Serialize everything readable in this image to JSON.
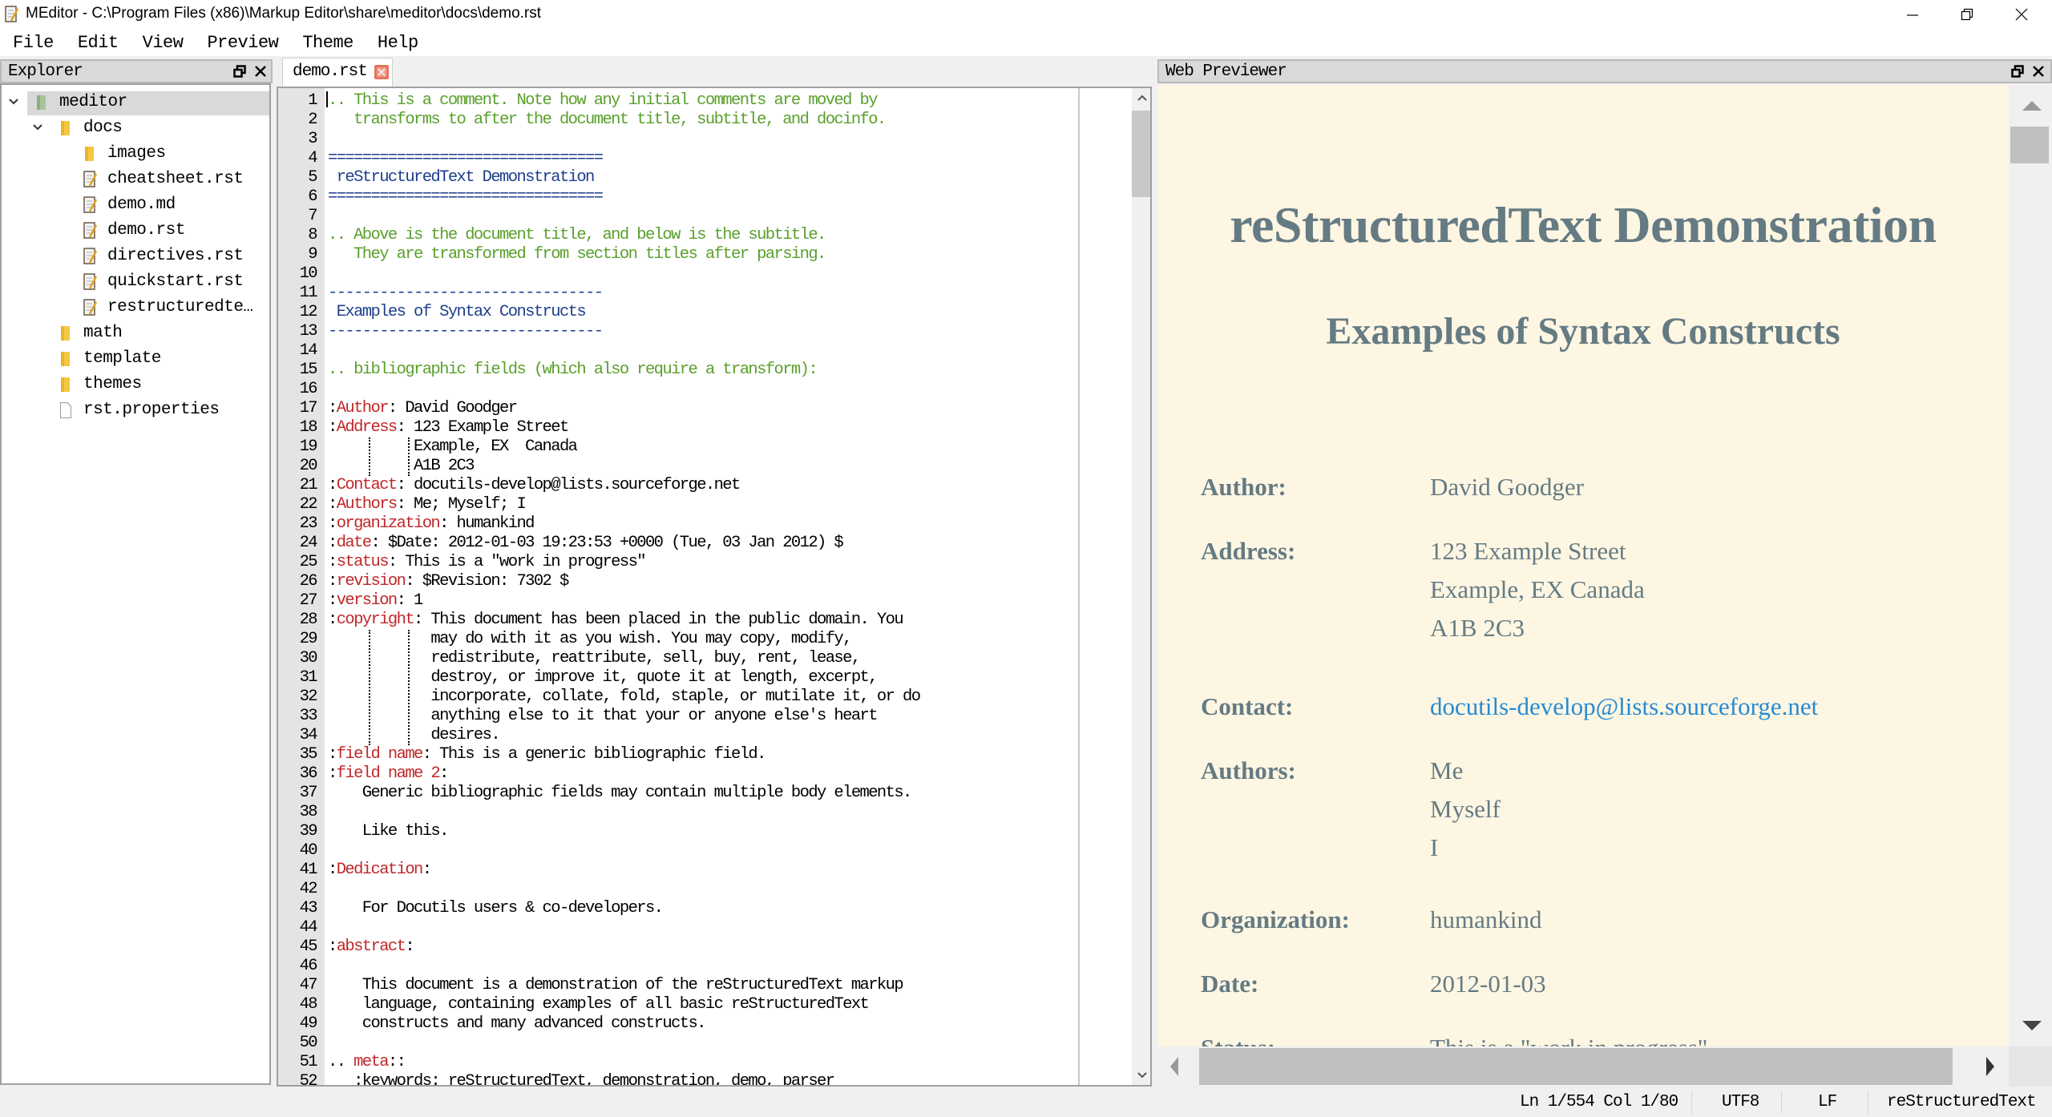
{
  "window": {
    "title": "MEditor - C:\\Program Files (x86)\\Markup Editor\\share\\meditor\\docs\\demo.rst",
    "controls": [
      "minimize",
      "restore",
      "close"
    ]
  },
  "menu": [
    "File",
    "Edit",
    "View",
    "Preview",
    "Theme",
    "Help"
  ],
  "explorer": {
    "title": "Explorer",
    "tree": [
      {
        "label": "meditor",
        "type": "root-folder",
        "depth": 0,
        "expanded": true,
        "selected": true
      },
      {
        "label": "docs",
        "type": "folder",
        "depth": 1,
        "expanded": true
      },
      {
        "label": "images",
        "type": "folder",
        "depth": 2
      },
      {
        "label": "cheatsheet.rst",
        "type": "doc",
        "depth": 2
      },
      {
        "label": "demo.md",
        "type": "doc",
        "depth": 2
      },
      {
        "label": "demo.rst",
        "type": "doc",
        "depth": 2
      },
      {
        "label": "directives.rst",
        "type": "doc",
        "depth": 2
      },
      {
        "label": "quickstart.rst",
        "type": "doc",
        "depth": 2
      },
      {
        "label": "restructuredte…",
        "type": "doc",
        "depth": 2
      },
      {
        "label": "math",
        "type": "folder",
        "depth": 1
      },
      {
        "label": "template",
        "type": "folder",
        "depth": 1
      },
      {
        "label": "themes",
        "type": "folder",
        "depth": 1
      },
      {
        "label": "rst.properties",
        "type": "file",
        "depth": 1
      }
    ]
  },
  "editor": {
    "tab": {
      "label": "demo.rst",
      "close_icon": "close-tab-icon"
    },
    "lines": [
      [
        {
          "t": ".. This is a comment. Note how any initial comments are moved by",
          "c": "comment"
        }
      ],
      [
        {
          "t": "   transforms to after the document title, subtitle, and docinfo.",
          "c": "comment"
        }
      ],
      [],
      [
        {
          "t": "================================",
          "c": "title"
        }
      ],
      [
        {
          "t": " reStructuredText Demonstration",
          "c": "title"
        }
      ],
      [
        {
          "t": "================================",
          "c": "title"
        }
      ],
      [],
      [
        {
          "t": ".. Above is the document title, and below is the subtitle.",
          "c": "comment"
        }
      ],
      [
        {
          "t": "   They are transformed from section titles after parsing.",
          "c": "comment"
        }
      ],
      [],
      [
        {
          "t": "--------------------------------",
          "c": "title"
        }
      ],
      [
        {
          "t": " Examples of Syntax Constructs",
          "c": "title"
        }
      ],
      [
        {
          "t": "--------------------------------",
          "c": "title"
        }
      ],
      [],
      [
        {
          "t": ".. bibliographic fields (which also require a transform):",
          "c": "comment"
        }
      ],
      [],
      [
        {
          "t": ":",
          "c": "plain"
        },
        {
          "t": "Author",
          "c": "field"
        },
        {
          "t": ": David Goodger",
          "c": "plain"
        }
      ],
      [
        {
          "t": ":",
          "c": "plain"
        },
        {
          "t": "Address",
          "c": "field"
        },
        {
          "t": ": 123 Example Street",
          "c": "plain"
        }
      ],
      [
        {
          "t": "          Example, EX  Canada",
          "c": "plain"
        }
      ],
      [
        {
          "t": "          A1B 2C3",
          "c": "plain"
        }
      ],
      [
        {
          "t": ":",
          "c": "plain"
        },
        {
          "t": "Contact",
          "c": "field"
        },
        {
          "t": ": docutils-develop@lists.sourceforge.net",
          "c": "plain"
        }
      ],
      [
        {
          "t": ":",
          "c": "plain"
        },
        {
          "t": "Authors",
          "c": "field"
        },
        {
          "t": ": Me; Myself; I",
          "c": "plain"
        }
      ],
      [
        {
          "t": ":",
          "c": "plain"
        },
        {
          "t": "organization",
          "c": "field"
        },
        {
          "t": ": humankind",
          "c": "plain"
        }
      ],
      [
        {
          "t": ":",
          "c": "plain"
        },
        {
          "t": "date",
          "c": "field"
        },
        {
          "t": ": $Date: 2012-01-03 19:23:53 +0000 (Tue, 03 Jan 2012) $",
          "c": "plain"
        }
      ],
      [
        {
          "t": ":",
          "c": "plain"
        },
        {
          "t": "status",
          "c": "field"
        },
        {
          "t": ": This is a \"work in progress\"",
          "c": "plain"
        }
      ],
      [
        {
          "t": ":",
          "c": "plain"
        },
        {
          "t": "revision",
          "c": "field"
        },
        {
          "t": ": $Revision: 7302 $",
          "c": "plain"
        }
      ],
      [
        {
          "t": ":",
          "c": "plain"
        },
        {
          "t": "version",
          "c": "field"
        },
        {
          "t": ": 1",
          "c": "plain"
        }
      ],
      [
        {
          "t": ":",
          "c": "plain"
        },
        {
          "t": "copyright",
          "c": "field"
        },
        {
          "t": ": This document has been placed in the public domain. You",
          "c": "plain"
        }
      ],
      [
        {
          "t": "            may do with it as you wish. You may copy, modify,",
          "c": "plain"
        }
      ],
      [
        {
          "t": "            redistribute, reattribute, sell, buy, rent, lease,",
          "c": "plain"
        }
      ],
      [
        {
          "t": "            destroy, or improve it, quote it at length, excerpt,",
          "c": "plain"
        }
      ],
      [
        {
          "t": "            incorporate, collate, fold, staple, or mutilate it, or do",
          "c": "plain"
        }
      ],
      [
        {
          "t": "            anything else to it that your or anyone else's heart",
          "c": "plain"
        }
      ],
      [
        {
          "t": "            desires.",
          "c": "plain"
        }
      ],
      [
        {
          "t": ":",
          "c": "plain"
        },
        {
          "t": "field name",
          "c": "field"
        },
        {
          "t": ": This is a generic bibliographic field.",
          "c": "plain"
        }
      ],
      [
        {
          "t": ":",
          "c": "plain"
        },
        {
          "t": "field name 2",
          "c": "field"
        },
        {
          "t": ":",
          "c": "plain"
        }
      ],
      [
        {
          "t": "    Generic bibliographic fields may contain multiple body elements.",
          "c": "plain"
        }
      ],
      [],
      [
        {
          "t": "    Like this.",
          "c": "plain"
        }
      ],
      [],
      [
        {
          "t": ":",
          "c": "plain"
        },
        {
          "t": "Dedication",
          "c": "field"
        },
        {
          "t": ":",
          "c": "plain"
        }
      ],
      [],
      [
        {
          "t": "    For Docutils users & co-developers.",
          "c": "plain"
        }
      ],
      [],
      [
        {
          "t": ":",
          "c": "plain"
        },
        {
          "t": "abstract",
          "c": "field"
        },
        {
          "t": ":",
          "c": "plain"
        }
      ],
      [],
      [
        {
          "t": "    This document is a demonstration of the reStructuredText markup",
          "c": "plain"
        }
      ],
      [
        {
          "t": "    language, containing examples of all basic reStructuredText",
          "c": "plain"
        }
      ],
      [
        {
          "t": "    constructs and many advanced constructs.",
          "c": "plain"
        }
      ],
      [],
      [
        {
          "t": ".. ",
          "c": "plain"
        },
        {
          "t": "meta",
          "c": "field"
        },
        {
          "t": "::",
          "c": "plain"
        }
      ],
      [
        {
          "t": "   :keywords: reStructuredText, demonstration, demo, parser",
          "c": "plain"
        }
      ]
    ]
  },
  "previewer": {
    "title": "Web Previewer",
    "h1": "reStructuredText Demonstration",
    "h2": "Examples of Syntax Constructs",
    "fields": [
      {
        "label": "Author:",
        "values": [
          "David Goodger"
        ]
      },
      {
        "label": "Address:",
        "values": [
          "123 Example Street",
          "Example, EX  Canada",
          "A1B 2C3"
        ]
      },
      {
        "label": "Contact:",
        "values": [
          "docutils-develop@lists.sourceforge.net"
        ],
        "link": true
      },
      {
        "label": "Authors:",
        "values": [
          "Me",
          "Myself",
          "I"
        ]
      },
      {
        "label": "Organization:",
        "values": [
          "humankind"
        ]
      },
      {
        "label": "Date:",
        "values": [
          "2012-01-03"
        ]
      },
      {
        "label": "Status:",
        "values": [
          "This is a \"work in progress\""
        ]
      }
    ]
  },
  "statusbar": {
    "position": "Ln 1/554 Col 1/80",
    "encoding": "UTF8",
    "line_ending": "LF",
    "language": "reStructuredText"
  },
  "colors": {
    "comment": "#5aa02c",
    "title": "#1f3f8c",
    "field": "#c0282a",
    "preview_bg": "#fdf6e3",
    "preview_text": "#657b83",
    "preview_link": "#268bd2"
  }
}
